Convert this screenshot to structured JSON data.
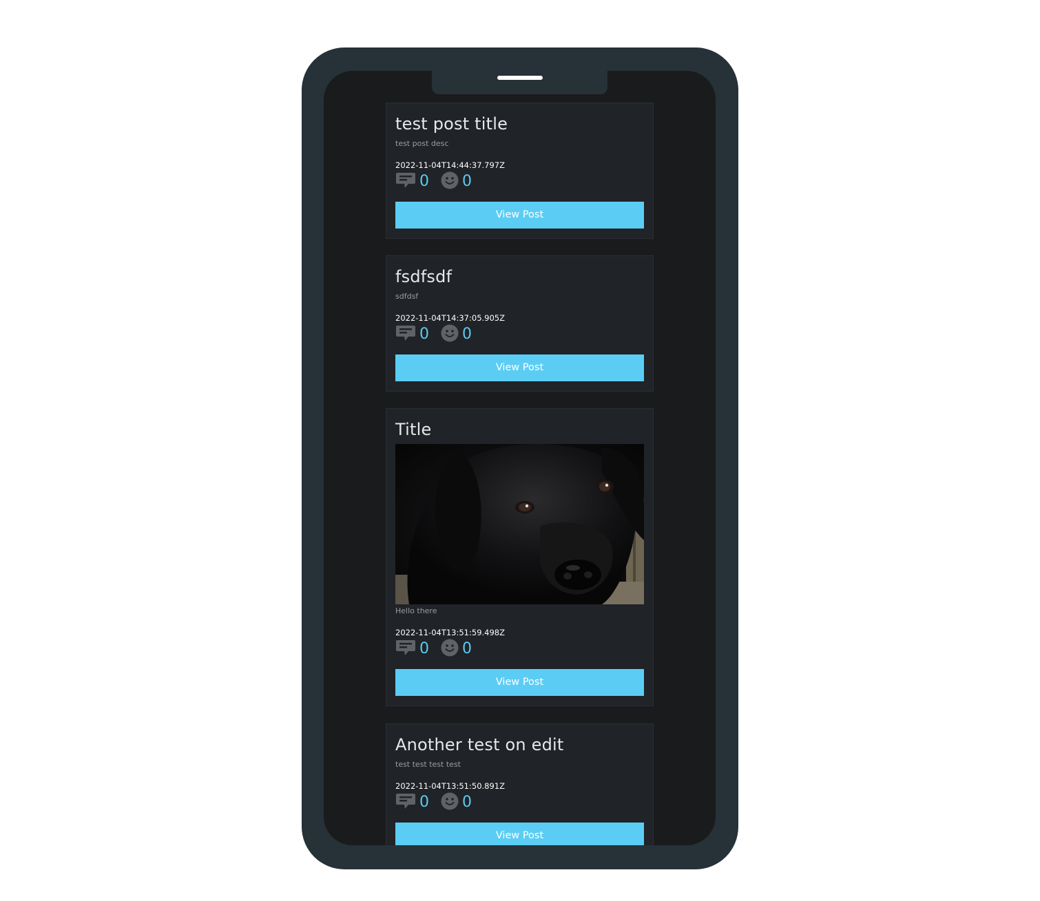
{
  "posts": [
    {
      "title": "test post title",
      "description": "test post desc",
      "date": "2022-11-04T14:44:37.797Z",
      "comments": "0",
      "reactions": "0",
      "button_label": "View Post"
    },
    {
      "title": "fsdfsdf",
      "description": "sdfdsf",
      "date": "2022-11-04T14:37:05.905Z",
      "comments": "0",
      "reactions": "0",
      "button_label": "View Post"
    },
    {
      "title": "Title",
      "description": "Hello there",
      "date": "2022-11-04T13:51:59.498Z",
      "comments": "0",
      "reactions": "0",
      "button_label": "View Post",
      "image": "black-labrador-puppy-photo"
    },
    {
      "title": "Another test on edit",
      "description": "test test test test",
      "date": "2022-11-04T13:51:50.891Z",
      "comments": "0",
      "reactions": "0",
      "button_label": "View Post"
    }
  ],
  "icons": {
    "comment": "comment-icon",
    "reaction": "smiley-icon"
  },
  "colors": {
    "accent": "#5bcdf5",
    "count": "#5ccbf3",
    "card_background": "#202327",
    "screen_background": "#1a1b1d",
    "phone_frame": "#263138"
  }
}
